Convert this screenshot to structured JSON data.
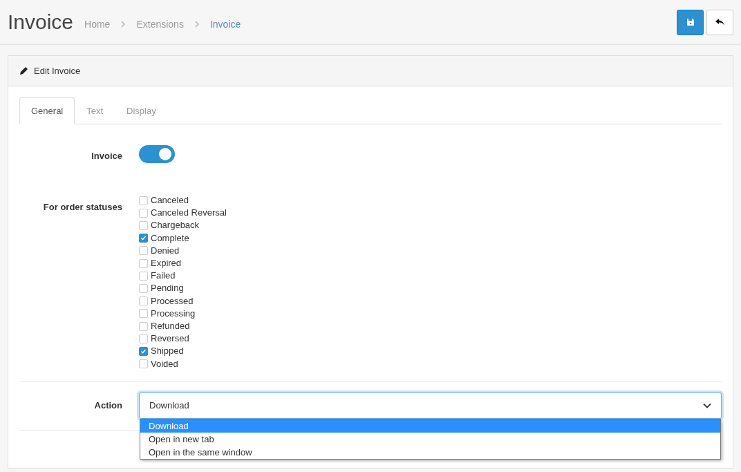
{
  "page": {
    "title": "Invoice",
    "breadcrumb": [
      {
        "label": "Home",
        "selected": false
      },
      {
        "label": "Extensions",
        "selected": false
      },
      {
        "label": "Invoice",
        "selected": true
      }
    ]
  },
  "card": {
    "title": "Edit Invoice"
  },
  "tabs": [
    {
      "label": "General",
      "selected": true
    },
    {
      "label": "Text",
      "selected": false
    },
    {
      "label": "Display",
      "selected": false
    }
  ],
  "invoice": {
    "label": "Invoice",
    "on": true
  },
  "statuses": {
    "label": "For order statuses",
    "items": [
      {
        "label": "Canceled",
        "checked": false
      },
      {
        "label": "Canceled Reversal",
        "checked": false
      },
      {
        "label": "Chargeback",
        "checked": false
      },
      {
        "label": "Complete",
        "checked": true
      },
      {
        "label": "Denied",
        "checked": false
      },
      {
        "label": "Expired",
        "checked": false
      },
      {
        "label": "Failed",
        "checked": false
      },
      {
        "label": "Pending",
        "checked": false
      },
      {
        "label": "Processed",
        "checked": false
      },
      {
        "label": "Processing",
        "checked": false
      },
      {
        "label": "Refunded",
        "checked": false
      },
      {
        "label": "Reversed",
        "checked": false
      },
      {
        "label": "Shipped",
        "checked": true
      },
      {
        "label": "Voided",
        "checked": false
      }
    ]
  },
  "action": {
    "label": "Action",
    "value": "Download",
    "expanded": true,
    "options": [
      {
        "label": "Download",
        "selected": true
      },
      {
        "label": "Open in new tab",
        "selected": false
      },
      {
        "label": "Open in the same window",
        "selected": false
      }
    ]
  }
}
